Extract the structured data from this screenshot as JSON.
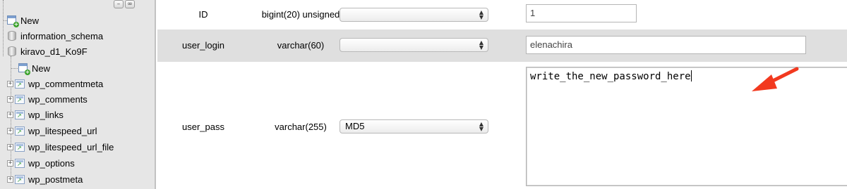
{
  "sidebar": {
    "toolbar": {
      "collapse_label": "–",
      "link_label": "∞"
    },
    "items": [
      {
        "label": "New",
        "icon": "new-icon"
      },
      {
        "label": "information_schema",
        "icon": "database-icon"
      },
      {
        "label": "kiravo_d1_Ko9F",
        "icon": "database-icon"
      },
      {
        "label": "New",
        "icon": "new-icon"
      },
      {
        "label": "wp_commentmeta",
        "icon": "table-icon"
      },
      {
        "label": "wp_comments",
        "icon": "table-icon"
      },
      {
        "label": "wp_links",
        "icon": "table-icon"
      },
      {
        "label": "wp_litespeed_url",
        "icon": "table-icon"
      },
      {
        "label": "wp_litespeed_url_file",
        "icon": "table-icon"
      },
      {
        "label": "wp_options",
        "icon": "table-icon"
      },
      {
        "label": "wp_postmeta",
        "icon": "table-icon"
      }
    ]
  },
  "rows": [
    {
      "name": "ID",
      "type": "bigint(20) unsigned",
      "function": "",
      "value": "1"
    },
    {
      "name": "user_login",
      "type": "varchar(60)",
      "function": "",
      "value": "elenachira"
    },
    {
      "name": "user_pass",
      "type": "varchar(255)",
      "function": "MD5",
      "value": "write_the_new_password_here"
    }
  ],
  "colors": {
    "annotation_arrow": "#f2391f",
    "alt_row": "#dfdfdf",
    "sidebar_bg": "#e6e6e6"
  }
}
